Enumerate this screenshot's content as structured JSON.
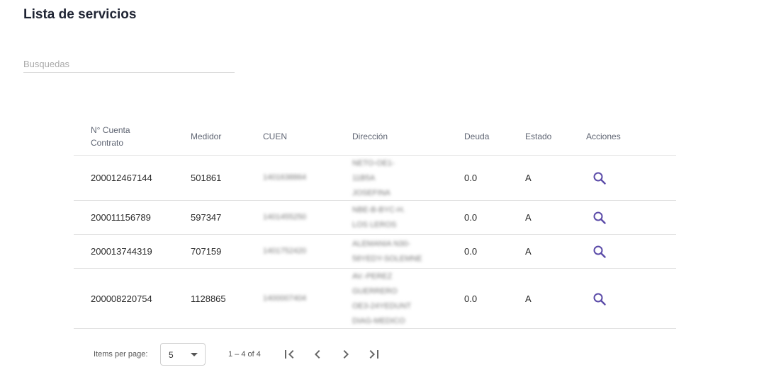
{
  "page": {
    "title": "Lista de servicios"
  },
  "search": {
    "placeholder": "Busquedas",
    "value": ""
  },
  "table": {
    "headers": {
      "cuenta": "N° Cuenta Contrato",
      "medidor": "Medidor",
      "cuen": "CUEN",
      "direccion": "Dirección",
      "deuda": "Deuda",
      "estado": "Estado",
      "acciones": "Acciones"
    },
    "rows": [
      {
        "cuenta": "200012467144",
        "medidor": "501861",
        "cuen": "1401638864",
        "direccion": [
          "NETO-OE1-",
          "11B5A",
          "JOSEFINA"
        ],
        "deuda": "0.0",
        "estado": "A"
      },
      {
        "cuenta": "200011156789",
        "medidor": "597347",
        "cuen": "1401455250",
        "direccion": [
          "NBE-B-BYC-H.",
          "LOS LEROS"
        ],
        "deuda": "0.0",
        "estado": "A"
      },
      {
        "cuenta": "200013744319",
        "medidor": "707159",
        "cuen": "1401752420",
        "direccion": [
          "ALEMANIA N30-",
          "58YEDY-SOLEMNE"
        ],
        "deuda": "0.0",
        "estado": "A"
      },
      {
        "cuenta": "200008220754",
        "medidor": "1128865",
        "cuen": "1400007404",
        "direccion": [
          "AV.-PEREZ",
          "GUERRERO",
          "OE3-24YEDUNT",
          "DIAG-MEDICO"
        ],
        "deuda": "0.0",
        "estado": "A"
      }
    ],
    "action_icon": "search-icon",
    "accent_color": "#5b4ba8"
  },
  "paginator": {
    "items_per_page_label": "Items per page:",
    "page_size": "5",
    "range_label": "1 – 4 of 4",
    "icons": [
      "first-page-icon",
      "previous-page-icon",
      "next-page-icon",
      "last-page-icon"
    ]
  }
}
